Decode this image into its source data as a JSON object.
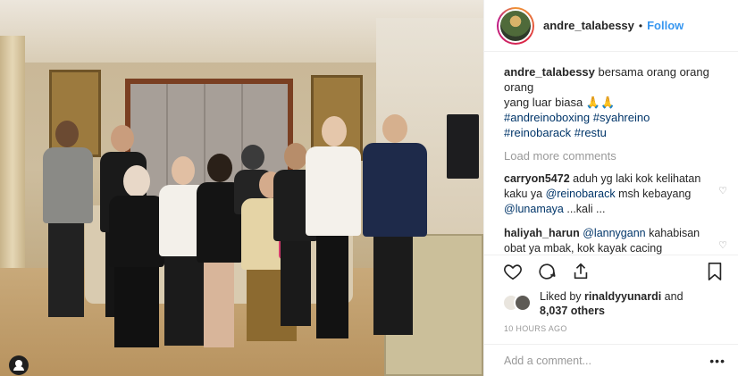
{
  "post": {
    "username": "andre_talabessy",
    "follow_label": "Follow",
    "separator": "•",
    "caption": {
      "username": "andre_talabessy",
      "line1": "bersama orang orang",
      "line2": "orang",
      "line3": "yang luar biasa",
      "emoji": "🙏🙏",
      "hashtags_line1": "#andreinoboxing #syahreino",
      "hashtags_line2": "#reinobarack #restu"
    },
    "load_more_label": "Load more comments",
    "comments": [
      {
        "username": "carryon5472",
        "text_before": "aduh yg laki kok kelihatan kaku ya",
        "mention1": "@reinobarack",
        "text_mid": "msh kebayang",
        "mention2": "@lunamaya",
        "text_after": "...kali ..."
      },
      {
        "username": "haliyah_harun",
        "mention": "@lannygann",
        "text": "kahabisan obat ya mbak, kok kayak cacing kepanasan"
      }
    ],
    "likes": {
      "prefix": "Liked by",
      "user": "rinaldyyunardi",
      "and": "and",
      "count": "8,037 others"
    },
    "timestamp": "10 HOURS AGO",
    "add_comment_placeholder": "Add a comment...",
    "more_label": "•••"
  },
  "icons": {
    "heart": "heart-icon",
    "comment": "comment-icon",
    "share": "share-icon",
    "save": "bookmark-icon",
    "user_tag": "user-tag-icon"
  },
  "colors": {
    "link_blue": "#3897f0",
    "hashtag": "#003569",
    "muted": "#999999",
    "text": "#262626"
  }
}
